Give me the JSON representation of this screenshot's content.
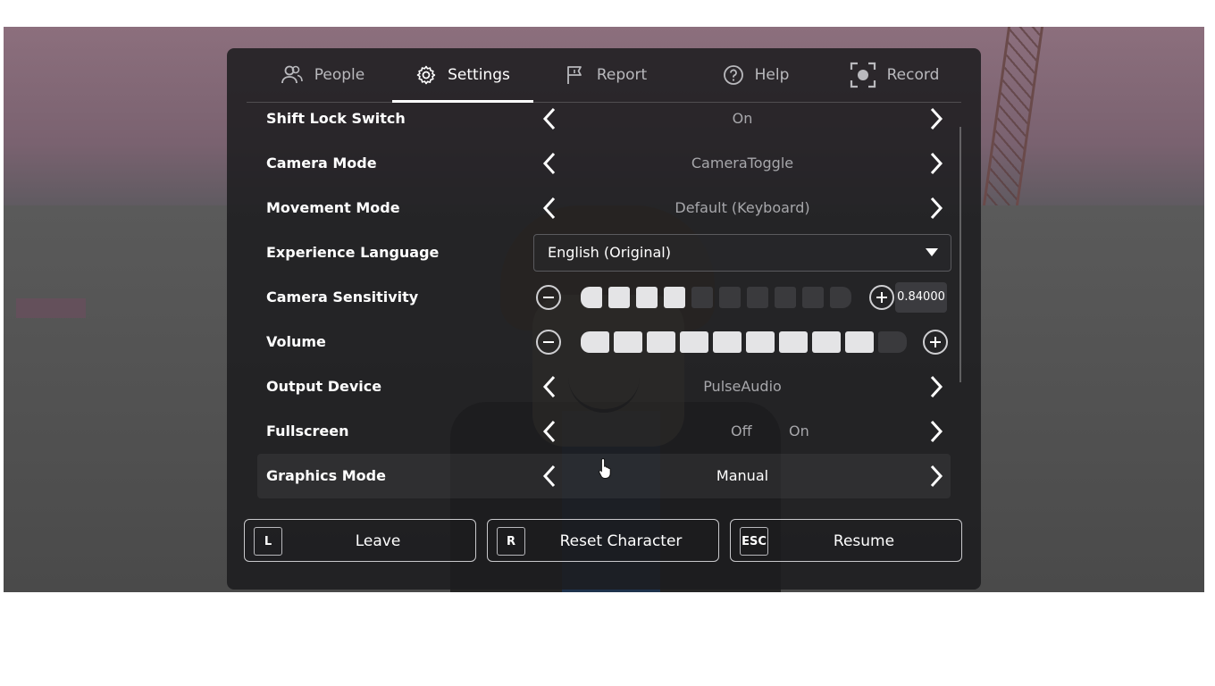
{
  "tabs": [
    {
      "label": "People",
      "icon": "people-icon",
      "active": false
    },
    {
      "label": "Settings",
      "icon": "gear-icon",
      "active": true
    },
    {
      "label": "Report",
      "icon": "flag-icon",
      "active": false
    },
    {
      "label": "Help",
      "icon": "help-icon",
      "active": false
    },
    {
      "label": "Record",
      "icon": "record-icon",
      "active": false
    }
  ],
  "settings": {
    "shift_lock": {
      "label": "Shift Lock Switch",
      "value": "On"
    },
    "camera_mode": {
      "label": "Camera Mode",
      "value": "CameraToggle"
    },
    "movement_mode": {
      "label": "Movement Mode",
      "value": "Default (Keyboard)"
    },
    "language": {
      "label": "Experience Language",
      "value": "English (Original)"
    },
    "camera_sensitivity": {
      "label": "Camera Sensitivity",
      "level": 4,
      "steps": 10,
      "value_text": "0.84000"
    },
    "volume": {
      "label": "Volume",
      "level": 9,
      "steps": 10
    },
    "output_device": {
      "label": "Output Device",
      "value": "PulseAudio"
    },
    "fullscreen": {
      "label": "Fullscreen",
      "off_label": "Off",
      "on_label": "On"
    },
    "graphics_mode": {
      "label": "Graphics Mode",
      "value": "Manual"
    }
  },
  "footer": {
    "leave": {
      "key": "L",
      "label": "Leave"
    },
    "reset": {
      "key": "R",
      "label": "Reset Character"
    },
    "resume": {
      "key": "ESC",
      "label": "Resume"
    }
  },
  "colors": {
    "accent": "#ffffff",
    "panel": "#1c1c1e",
    "bar_filled": "#e4e4e6",
    "bar_empty": "#3a3a3d"
  }
}
